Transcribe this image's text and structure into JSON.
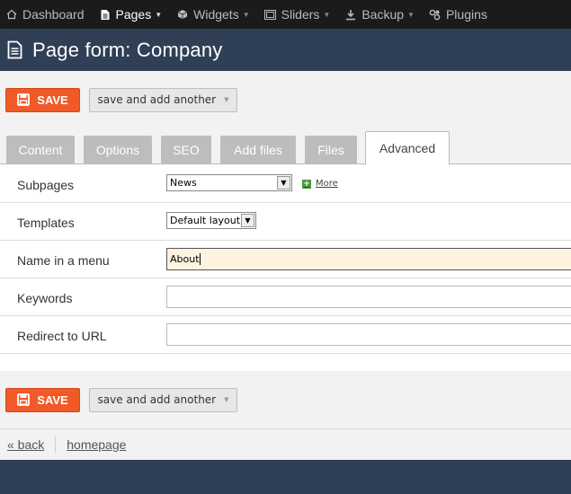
{
  "nav": {
    "items": [
      {
        "label": "Dashboard",
        "icon": "home-icon",
        "caret": false,
        "active": false
      },
      {
        "label": "Pages",
        "icon": "document-icon",
        "caret": true,
        "active": true
      },
      {
        "label": "Widgets",
        "icon": "cube-icon",
        "caret": true,
        "active": false
      },
      {
        "label": "Sliders",
        "icon": "image-icon",
        "caret": true,
        "active": false
      },
      {
        "label": "Backup",
        "icon": "download-icon",
        "caret": true,
        "active": false
      },
      {
        "label": "Plugins",
        "icon": "link-icon",
        "caret": false,
        "active": false
      }
    ]
  },
  "header": {
    "title": "Page form: Company",
    "icon": "document-icon"
  },
  "toolbar": {
    "save_label": "SAVE",
    "another_label": "save and add another"
  },
  "tabs": [
    "Content",
    "Options",
    "SEO",
    "Add files",
    "Files",
    "Advanced"
  ],
  "form": {
    "subpages": {
      "label": "Subpages",
      "value": "News",
      "more_label": "More"
    },
    "templates": {
      "label": "Templates",
      "value": "Default layout"
    },
    "menu_name": {
      "label": "Name in a menu",
      "value": "About"
    },
    "keywords": {
      "label": "Keywords",
      "value": ""
    },
    "redirect": {
      "label": "Redirect to URL",
      "value": ""
    }
  },
  "footer": {
    "back_label": "« back",
    "homepage_label": "homepage"
  },
  "colors": {
    "save": "#f05a28",
    "header": "#2f3f55",
    "nav": "#1b1b1b",
    "focus": "#fdf3de"
  }
}
